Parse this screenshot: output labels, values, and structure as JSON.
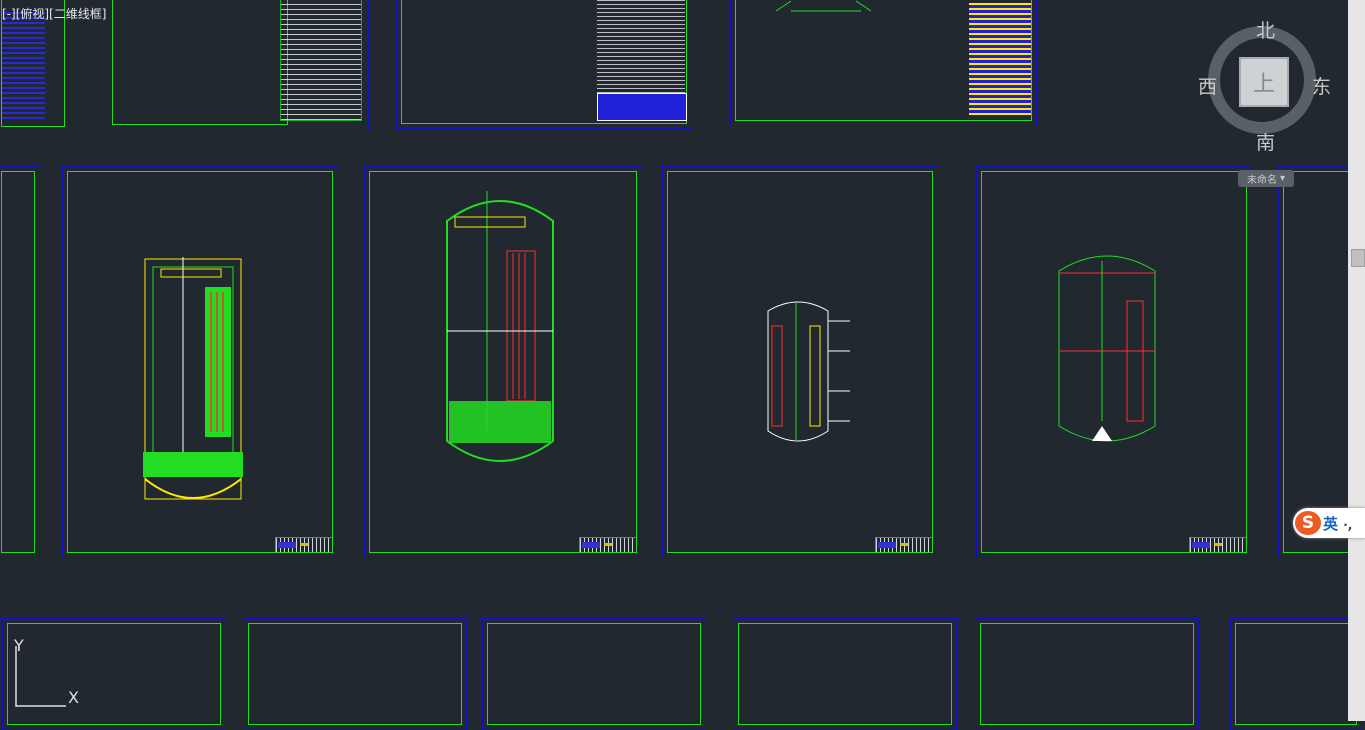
{
  "view_label": "[-][俯视][二维线框]",
  "viewcube": {
    "top_face": "上",
    "north": "北",
    "south": "南",
    "east": "东",
    "west": "西"
  },
  "wcs_menu": {
    "label": "未命名",
    "arrow": "▾"
  },
  "ime": {
    "logo": "S",
    "mode": "英",
    "extra": "·,"
  },
  "ucs": {
    "y_axis": "Y",
    "x_axis": "X"
  },
  "colors": {
    "background": "#212830",
    "sheet_border": "#1010c8",
    "frame": "#22dd22",
    "drawing_green": "#22dd22",
    "drawing_yellow": "#ffea00",
    "drawing_red": "#ff3030",
    "drawing_white": "#ffffff"
  }
}
